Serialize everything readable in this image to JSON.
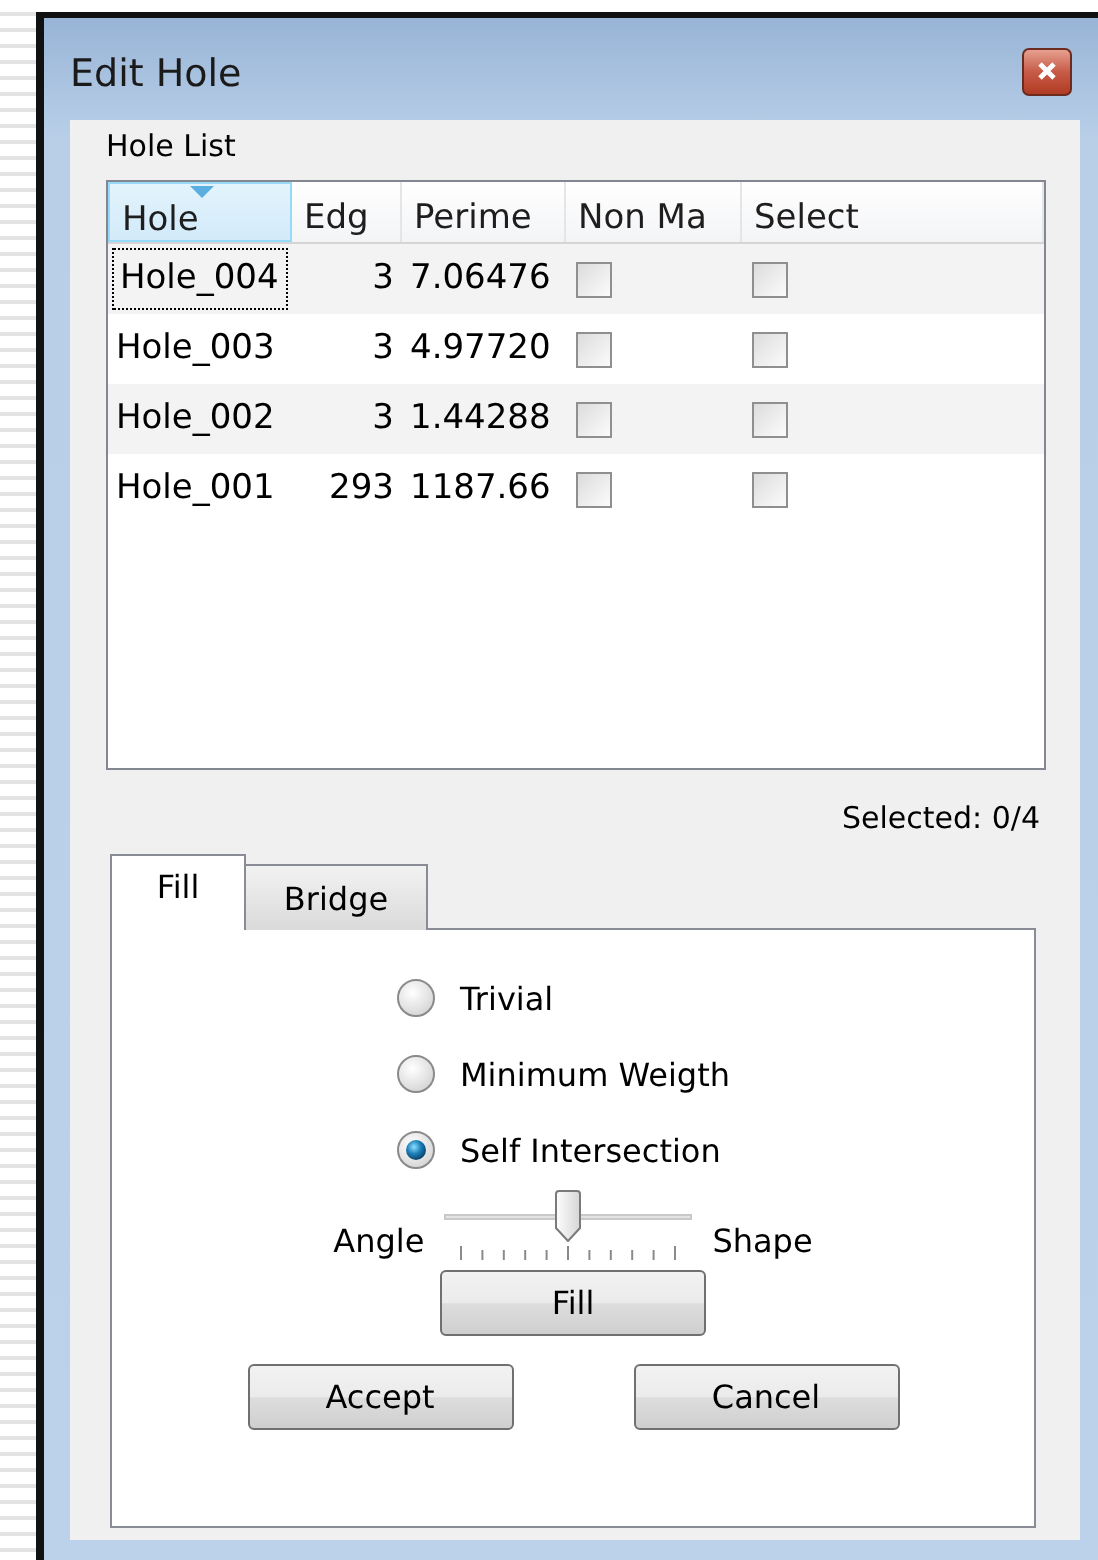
{
  "window": {
    "title": "Edit Hole"
  },
  "hole_list": {
    "label": "Hole List",
    "columns": [
      {
        "label": "Hole",
        "sorted": true
      },
      {
        "label": "Edg",
        "sorted": false
      },
      {
        "label": "Perime",
        "sorted": false
      },
      {
        "label": "Non Ma",
        "sorted": false
      },
      {
        "label": "Select",
        "sorted": false
      }
    ],
    "rows": [
      {
        "hole": "Hole_004",
        "edges": "3",
        "perimeter": "7.06476",
        "non_manifold": false,
        "select": false,
        "focused": true
      },
      {
        "hole": "Hole_003",
        "edges": "3",
        "perimeter": "4.97720",
        "non_manifold": false,
        "select": false,
        "focused": false
      },
      {
        "hole": "Hole_002",
        "edges": "3",
        "perimeter": "1.44288",
        "non_manifold": false,
        "select": false,
        "focused": false
      },
      {
        "hole": "Hole_001",
        "edges": "293",
        "perimeter": "1187.66",
        "non_manifold": false,
        "select": false,
        "focused": false
      }
    ]
  },
  "selected_count": "Selected: 0/4",
  "tabs": [
    {
      "label": "Fill",
      "selected": true
    },
    {
      "label": "Bridge",
      "selected": false
    }
  ],
  "fill_methods": [
    {
      "label": "Trivial",
      "selected": false
    },
    {
      "label": "Minimum Weigth",
      "selected": false
    },
    {
      "label": "Self Intersection",
      "selected": true
    }
  ],
  "slider": {
    "left_label": "Angle",
    "right_label": "Shape",
    "level": 0.5
  },
  "fill_button": "Fill",
  "buttons": [
    "Accept",
    "Cancel"
  ]
}
